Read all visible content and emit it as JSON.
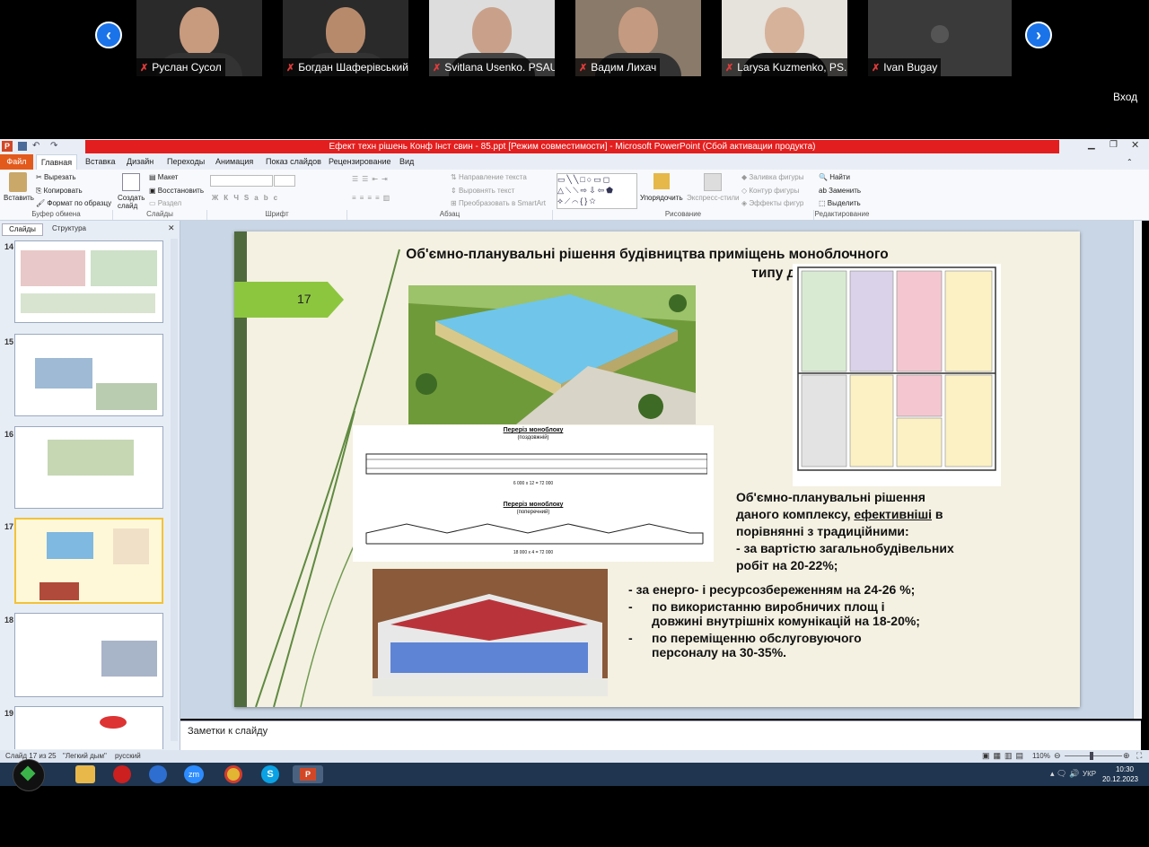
{
  "zoom": {
    "participants": [
      {
        "name": "Руслан Сусол"
      },
      {
        "name": "Богдан Шаферівський"
      },
      {
        "name": "Svitlana Usenko. PSAU"
      },
      {
        "name": "Вадим Лихач"
      },
      {
        "name": "Larysa Kuzmenko, PS..."
      },
      {
        "name": "Ivan Bugay"
      }
    ],
    "enter_label": "Вход"
  },
  "ppt": {
    "window_title": "Ефект техн рішень Конф Інст свин - 85.ppt [Режим совместимости] - Microsoft PowerPoint (Сбой активации продукта)",
    "tabs": [
      "Файл",
      "Главная",
      "Вставка",
      "Дизайн",
      "Переходы",
      "Анимация",
      "Показ слайдов",
      "Рецензирование",
      "Вид"
    ],
    "ribbon": {
      "paste": "Вставить",
      "cut": "Вырезать",
      "copy": "Копировать",
      "format_painter": "Формат по образцу",
      "clipboard_group": "Буфер обмена",
      "new_slide": "Создать слайд",
      "layout": "Макет",
      "reset": "Восстановить",
      "section": "Раздел",
      "slides_group": "Слайды",
      "font_group": "Шрифт",
      "text_direction": "Направление текста",
      "align_text": "Выровнять текст",
      "smartart": "Преобразовать в SmartArt",
      "paragraph_group": "Абзац",
      "arrange": "Упорядочить",
      "quick_styles": "Экспресс-стили",
      "shape_fill": "Заливка фигуры",
      "shape_outline": "Контур фигуры",
      "shape_effects": "Эффекты фигур",
      "drawing_group": "Рисование",
      "find": "Найти",
      "replace": "Заменить",
      "select": "Выделить",
      "editing_group": "Редактирование"
    },
    "panel_tabs": [
      "Слайды",
      "Структура"
    ],
    "thumb_numbers": [
      "14",
      "15",
      "16",
      "17",
      "18",
      "19"
    ],
    "slide": {
      "title_line1": "Об'ємно-планувальні  рішення будівництва приміщень моноблочного",
      "title_line2": "типу для виробництва  свинини",
      "number": "17",
      "section1_title": "Переріз моноблоку",
      "section1_sub": "(поздовжній)",
      "section1_dim": "6 000 х 12 = 72 000",
      "section2_title": "Переріз моноблоку",
      "section2_sub": "(поперечний)",
      "section2_dim": "18 000 х 4 = 72 000",
      "text_block": [
        "Об'ємно-планувальні рішення",
        "даного комплексу, ",
        "ефективніші",
        " в",
        "порівнянні з традиційними:",
        "- за вартістю загальнобудівельних",
        "робіт на 20-22%;"
      ],
      "bullets": [
        {
          "marker": "",
          "line1": "- за енерго- і ресурсозбереженням на 24-26 %;",
          "line2": ""
        },
        {
          "marker": "-",
          "line1": "по використанню виробничих площ і",
          "line2": "довжині внутрішніх комунікацій на 18-20%;"
        },
        {
          "marker": "-",
          "line1": "по переміщенню обслуговуючого",
          "line2": "персоналу на 30-35%."
        }
      ]
    },
    "notes_placeholder": "Заметки к слайду",
    "status": {
      "slide_info": "Слайд 17 из 25",
      "theme": "\"Легкий дым\"",
      "language": "русский",
      "zoom": "110%"
    }
  },
  "taskbar": {
    "lang": "УКР",
    "time": "10:30",
    "date": "20.12.2023"
  },
  "colors": {
    "accent_green": "#8cc63f",
    "title_red": "#e31e1e",
    "zoom_blue": "#1a73e8"
  }
}
